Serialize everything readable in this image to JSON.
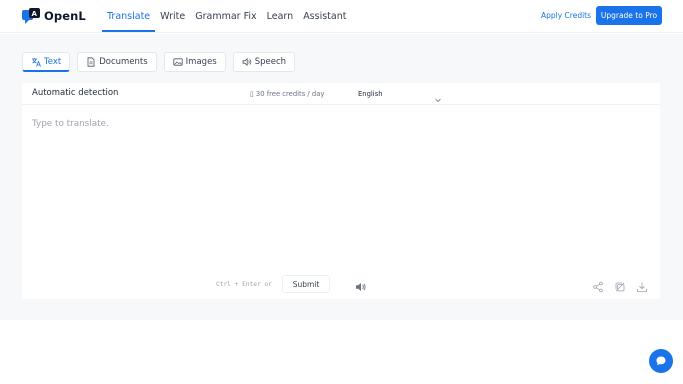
{
  "brand": {
    "name": "OpenL",
    "accent": "#1a73e8"
  },
  "nav": {
    "items": [
      {
        "label": "Translate",
        "active": true
      },
      {
        "label": "Write"
      },
      {
        "label": "Grammar Fix"
      },
      {
        "label": "Learn"
      },
      {
        "label": "Assistant"
      }
    ],
    "apply_credits": "Apply Credits",
    "upgrade": "Upgrade to Pro"
  },
  "tabs": [
    {
      "label": "Text",
      "icon": "text-translate-icon",
      "active": true
    },
    {
      "label": "Documents",
      "icon": "document-icon"
    },
    {
      "label": "Images",
      "icon": "image-icon"
    },
    {
      "label": "Speech",
      "icon": "speaker-icon"
    }
  ],
  "translator": {
    "source_lang": "Automatic detection",
    "credits_note": "30 free credits / day",
    "target_lang": "English",
    "placeholder": "Type to translate.",
    "shortcut": "Ctrl + Enter or",
    "submit": "Submit"
  }
}
